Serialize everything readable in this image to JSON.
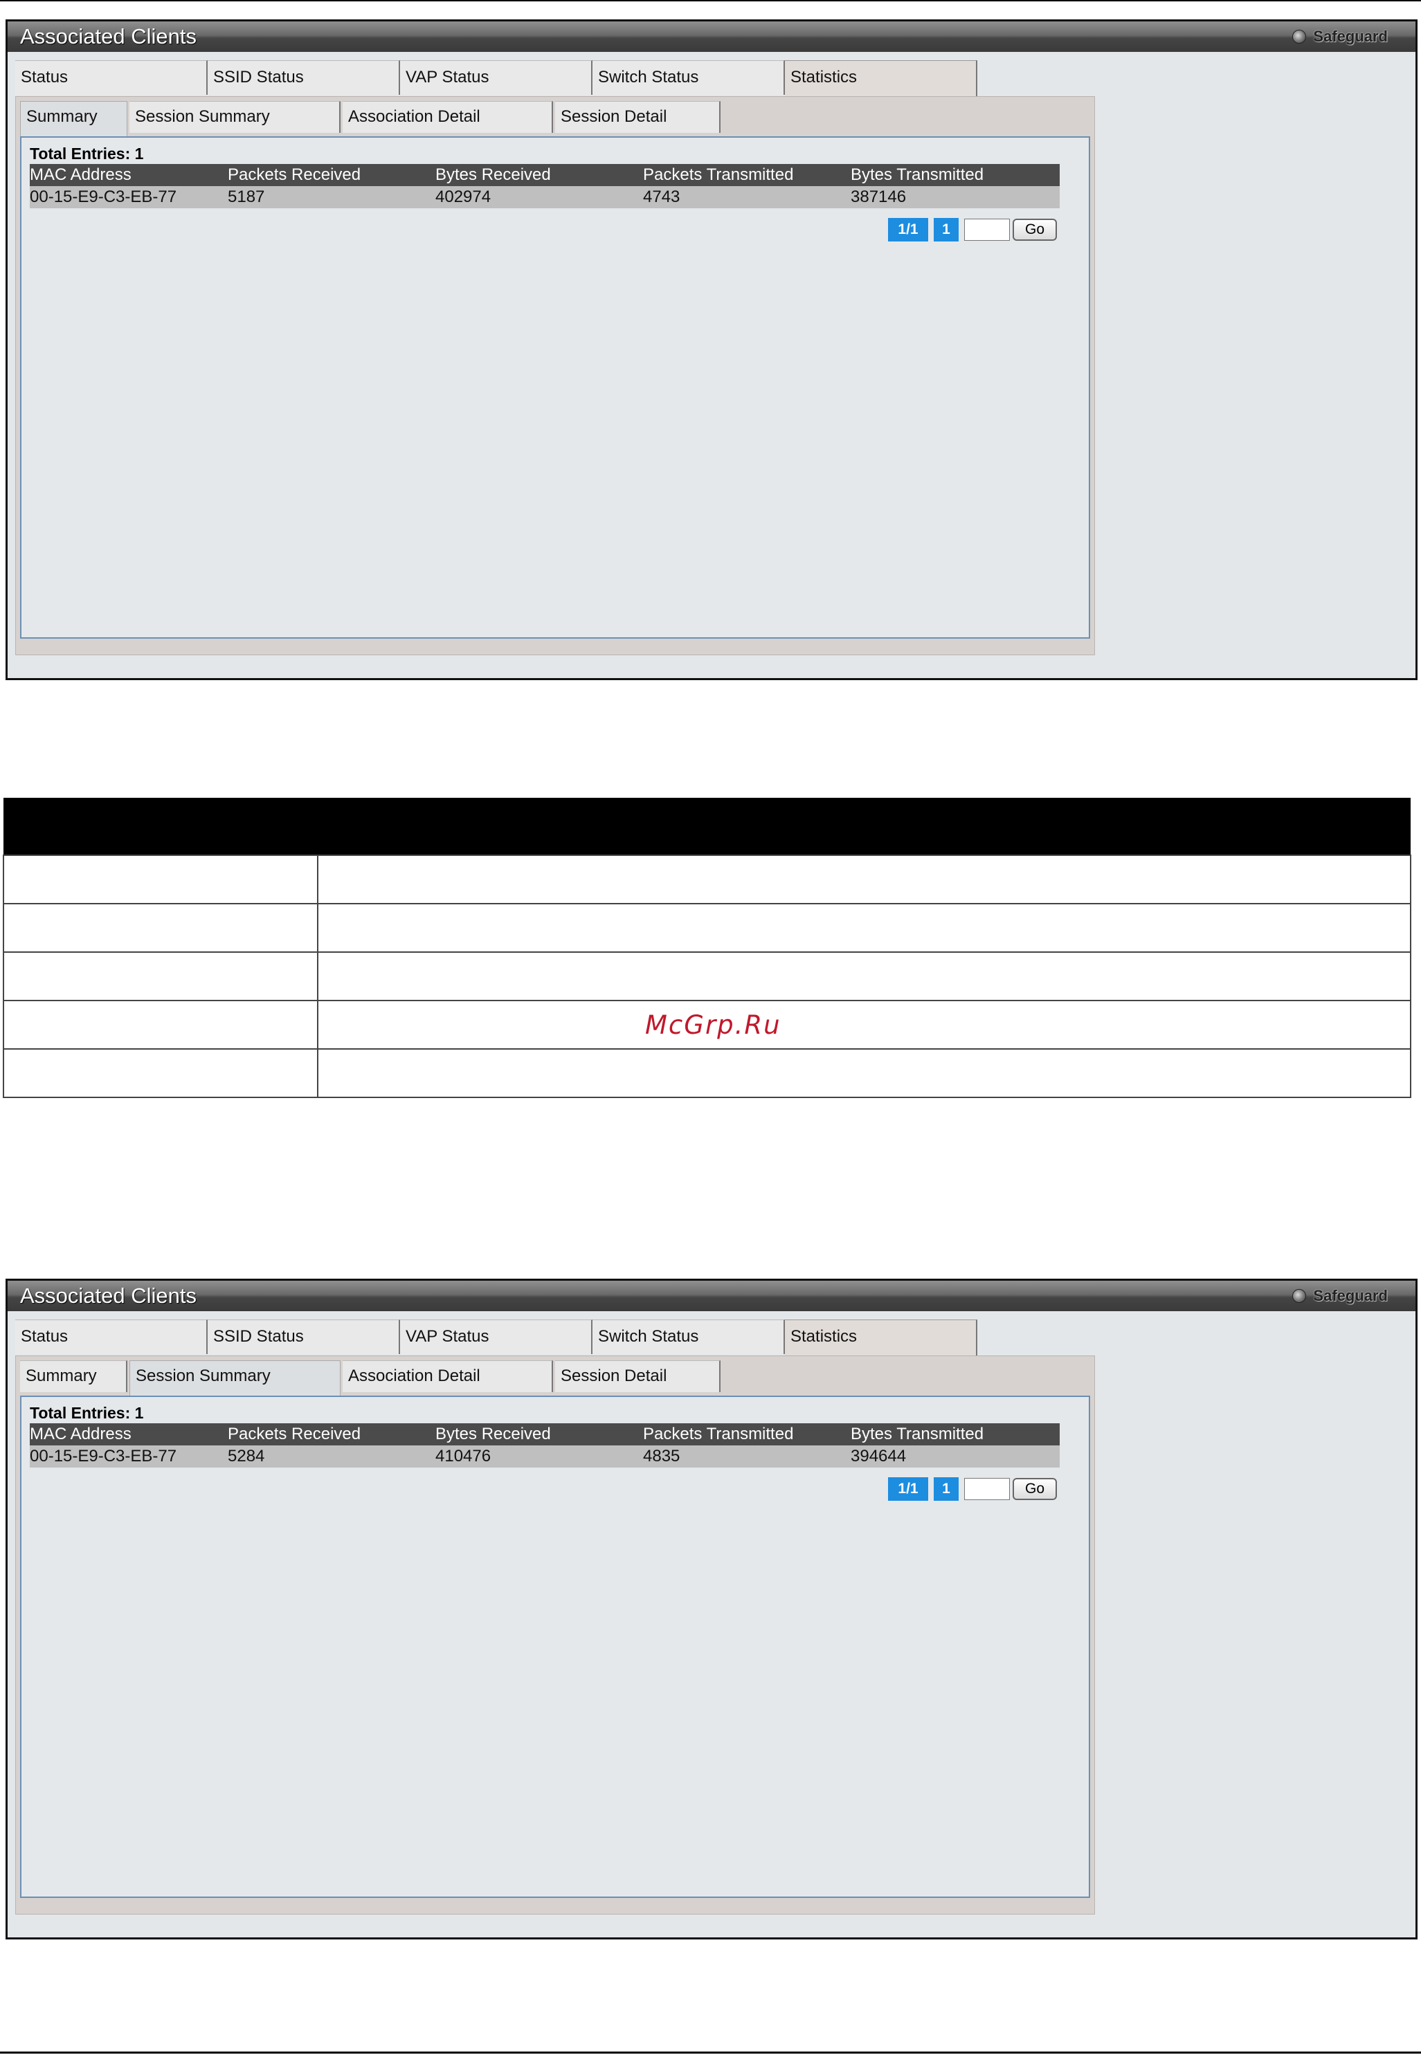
{
  "panels": [
    {
      "title": "Associated Clients",
      "safeguard_label": "Safeguard",
      "top_tabs": [
        {
          "label": "Status"
        },
        {
          "label": "SSID Status"
        },
        {
          "label": "VAP Status"
        },
        {
          "label": "Switch Status"
        },
        {
          "label": "Statistics",
          "active": true
        }
      ],
      "sub_tabs": [
        {
          "label": "Summary",
          "active": true
        },
        {
          "label": "Session Summary"
        },
        {
          "label": "Association Detail"
        },
        {
          "label": "Session Detail"
        }
      ],
      "total_entries": "Total Entries: 1",
      "columns": [
        "MAC Address",
        "Packets Received",
        "Bytes Received",
        "Packets Transmitted",
        "Bytes Transmitted"
      ],
      "rows": [
        [
          "00-15-E9-C3-EB-77",
          "5187",
          "402974",
          "4743",
          "387146"
        ]
      ],
      "pager": {
        "page_of": "1/1",
        "page": "1",
        "go_label": "Go"
      }
    },
    {
      "title": "Associated Clients",
      "safeguard_label": "Safeguard",
      "top_tabs": [
        {
          "label": "Status"
        },
        {
          "label": "SSID Status"
        },
        {
          "label": "VAP Status"
        },
        {
          "label": "Switch Status"
        },
        {
          "label": "Statistics",
          "active": true
        }
      ],
      "sub_tabs": [
        {
          "label": "Summary"
        },
        {
          "label": "Session Summary",
          "active": true
        },
        {
          "label": "Association Detail"
        },
        {
          "label": "Session Detail"
        }
      ],
      "total_entries": "Total Entries: 1",
      "columns": [
        "MAC Address",
        "Packets Received",
        "Bytes Received",
        "Packets Transmitted",
        "Bytes Transmitted"
      ],
      "rows": [
        [
          "00-15-E9-C3-EB-77",
          "5284",
          "410476",
          "4835",
          "394644"
        ]
      ],
      "pager": {
        "page_of": "1/1",
        "page": "1",
        "go_label": "Go"
      }
    }
  ],
  "watermark": "McGrp.Ru",
  "colors": {
    "pager_blue": "#1d8de0",
    "watermark_red": "#c0182c",
    "header_dark": "#4b4b4b"
  }
}
